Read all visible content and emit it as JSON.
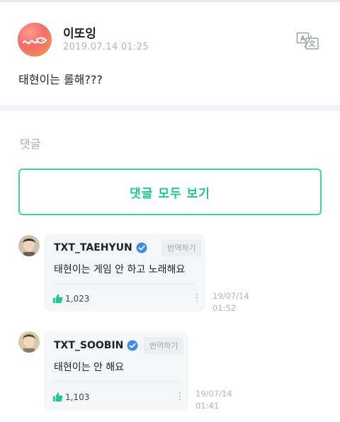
{
  "post": {
    "author": "이또잉",
    "date": "2019.07.14 01:25",
    "body": "태현이는 롤해???",
    "translate_icon": "translate-icon"
  },
  "comments_section": {
    "title": "댓글",
    "view_all_label": "댓글 모두 보기"
  },
  "comments": [
    {
      "username": "TXT_TAEHYUN",
      "verified": true,
      "translate_label": "번역하기",
      "text": "태현이는 게임 안 하고 노래해요",
      "likes": "1,023",
      "date_line1": "19/07/14",
      "date_line2": "01:52"
    },
    {
      "username": "TXT_SOOBIN",
      "verified": true,
      "translate_label": "번역하기",
      "text": "태현이는 안 해요",
      "likes": "1,103",
      "date_line1": "19/07/14",
      "date_line2": "01:41"
    }
  ],
  "colors": {
    "accent": "#1dc98e",
    "accent_border": "#3ed3a4",
    "verified": "#3b8ee8",
    "muted": "#b2b5bb"
  }
}
